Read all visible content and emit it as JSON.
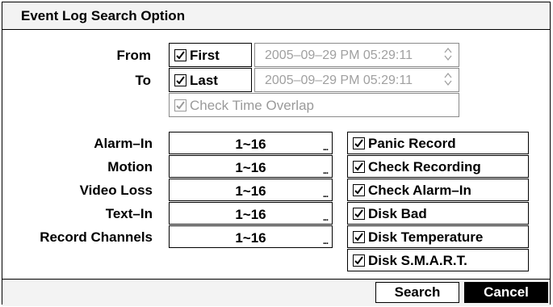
{
  "title": "Event Log Search Option",
  "from": {
    "label": "From",
    "checkbox_label": "First",
    "checked": true,
    "datetime": "2005–09–29  PM 05:29:11"
  },
  "to": {
    "label": "To",
    "checkbox_label": "Last",
    "checked": true,
    "datetime": "2005–09–29  PM 05:29:11"
  },
  "overlap": {
    "label": "Check Time Overlap",
    "checked": true,
    "disabled": true
  },
  "channels": [
    {
      "label": "Alarm–In",
      "value": "1~16"
    },
    {
      "label": "Motion",
      "value": "1~16"
    },
    {
      "label": "Video Loss",
      "value": "1~16"
    },
    {
      "label": "Text–In",
      "value": "1~16"
    },
    {
      "label": "Record Channels",
      "value": "1~16"
    }
  ],
  "events": [
    {
      "label": "Panic Record",
      "checked": true
    },
    {
      "label": "Check Recording",
      "checked": true
    },
    {
      "label": "Check Alarm–In",
      "checked": true
    },
    {
      "label": "Disk Bad",
      "checked": true
    },
    {
      "label": "Disk Temperature",
      "checked": true
    },
    {
      "label": "Disk S.M.A.R.T.",
      "checked": true
    }
  ],
  "buttons": {
    "search": "Search",
    "cancel": "Cancel"
  },
  "browse_glyph": "...",
  "colors": {
    "cancel_bg": "#000000",
    "cancel_fg": "#ffffff",
    "disabled": "#9a9a9a",
    "panel_bg": "#f3f3f3"
  }
}
